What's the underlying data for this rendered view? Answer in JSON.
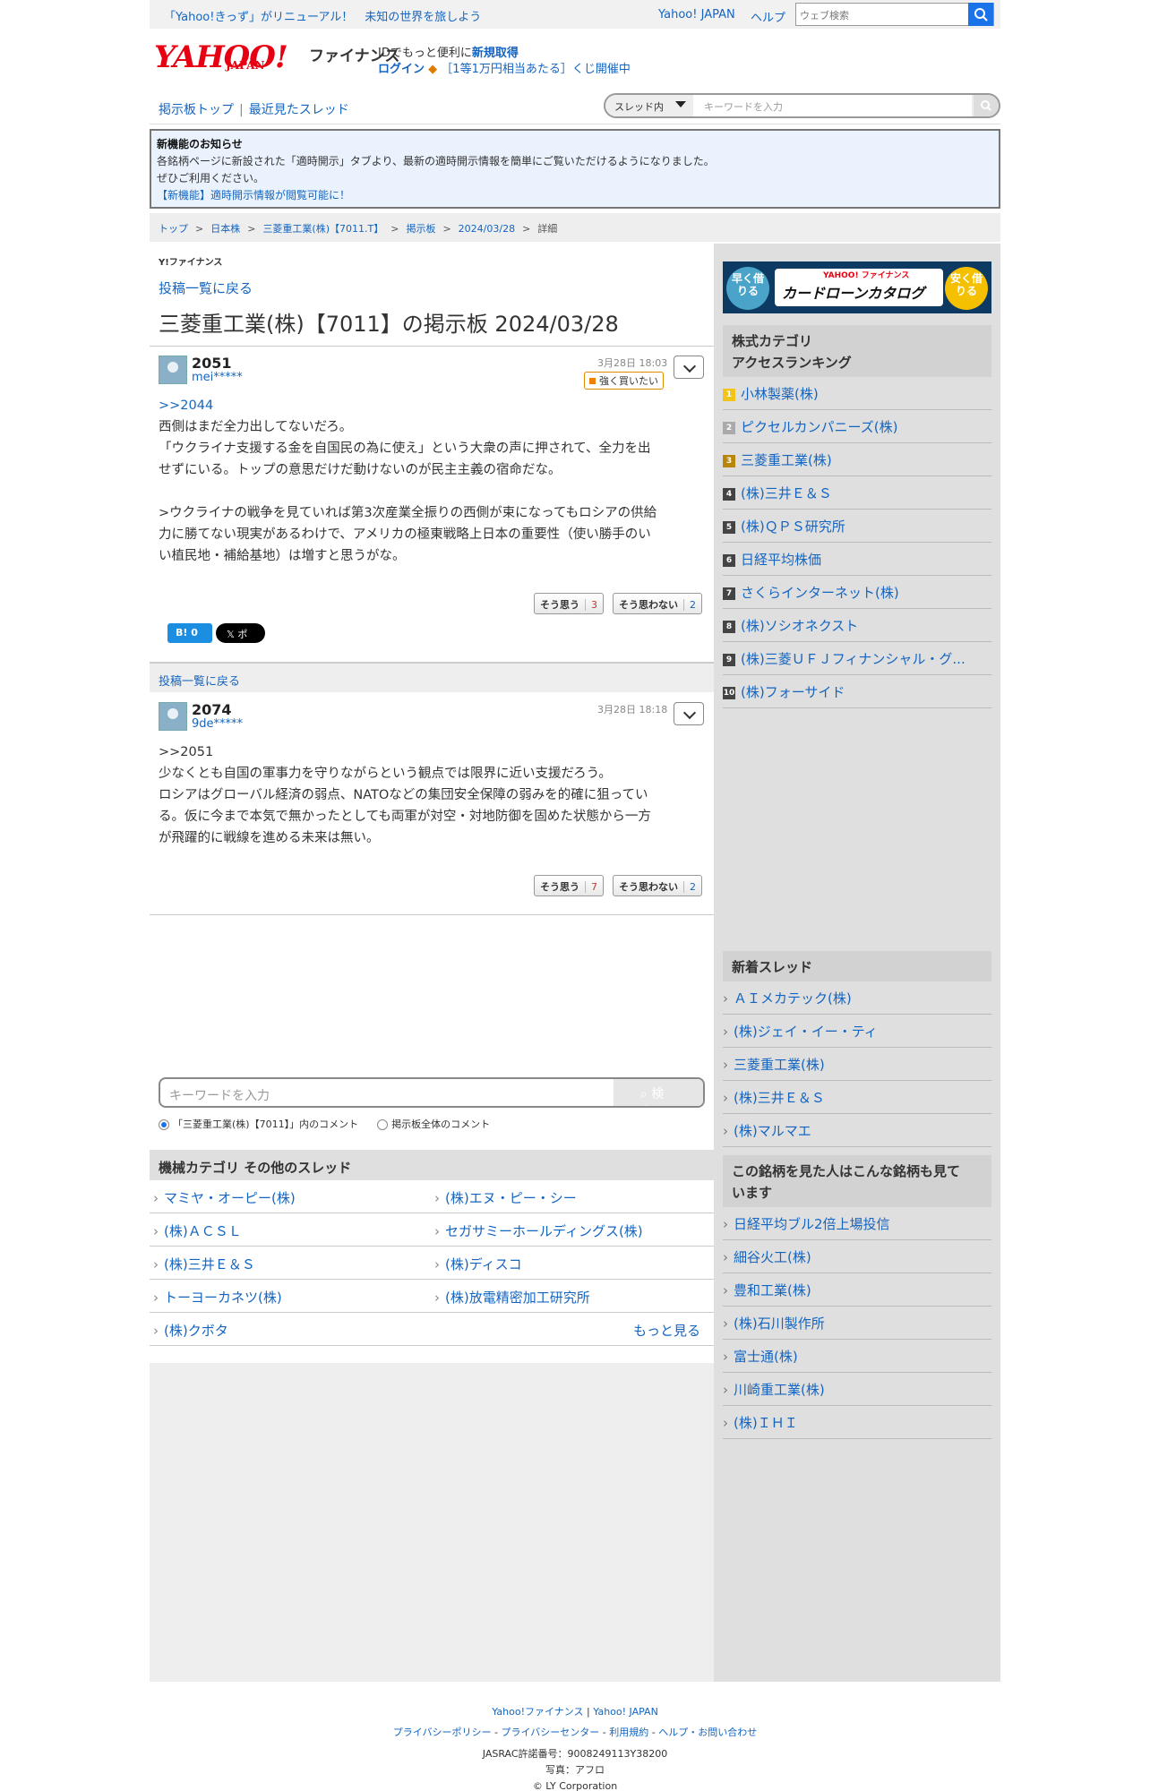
{
  "topbar": {
    "promo": "「Yahoo!きっず」がリニューアル！　未知の世界を旅しよう",
    "yahoo_japan": "Yahoo! JAPAN",
    "help": "ヘルプ",
    "search_placeholder": "ウェブ検索"
  },
  "header": {
    "logo": "YAHOO!",
    "logo_sub": "JAPAN",
    "service": "ファイナンス",
    "id_text": "IDでもっと便利に",
    "signup": "新規取得",
    "login": "ログイン",
    "lottery": "［1等1万円相当あたる］くじ開催中"
  },
  "nav": {
    "board_top": "掲示板トップ",
    "recent": "最近見たスレッド",
    "scope": "スレッド内",
    "placeholder": "キーワードを入力"
  },
  "notice": {
    "title": "新機能のお知らせ",
    "line1": "各銘柄ページに新設された「適時開示」タブより、最新の適時開示情報を簡単にご覧いただけるようになりました。",
    "line2": "ぜひご利用ください。",
    "link": "【新機能】適時開示情報が閲覧可能に！"
  },
  "breadcrumb": [
    "トップ",
    "日本株",
    "三菱重工業(株)【7011.T】",
    "掲示板",
    "2024/03/28",
    "詳細"
  ],
  "page": {
    "yf_small": "Y!ファイナンス",
    "back": "投稿一覧に戻る",
    "title": "三菱重工業(株)【7011】の掲示板 2024/03/28"
  },
  "posts": [
    {
      "num": "2051",
      "user": "mei*****",
      "date": "3月28日 18:03",
      "badge": "強く買いたい",
      "reply": ">>2044",
      "lines": [
        "西側はまだ全力出してないだろ。",
        "「ウクライナ支援する金を自国民の為に使え」という大衆の声に押されて、全力を出",
        "せずにいる。トップの意思だけだ動けないのが民主主義の宿命だな。",
        "",
        "&gt;ウクライナの戦争を見ていれば第3次産業全振りの西側が束になってもロシアの供給",
        "力に勝てない現実があるわけで、アメリカの極東戦略上日本の重要性（使い勝手のい",
        "い植民地・補給基地）は増すと思うがな。"
      ],
      "agree": "そう思う",
      "agree_n": "3",
      "disagree": "そう思わない",
      "disagree_n": "2"
    },
    {
      "num": "2074",
      "user": "9de*****",
      "date": "3月28日 18:18",
      "reply": ">>2051",
      "lines": [
        "少なくとも自国の軍事力を守りながらという観点では限界に近い支援だろう。",
        "ロシアはグローバル経済の弱点、NATOなどの集団安全保障の弱みを的確に狙ってい",
        "る。仮に今まで本気で無かったとしても両軍が対空・対地防御を固めた状態から一方",
        "が飛躍的に戦線を進める未来は無い。"
      ],
      "agree": "そう思う",
      "agree_n": "7",
      "disagree": "そう思わない",
      "disagree_n": "2"
    }
  ],
  "share": {
    "hatena": "B! 0",
    "x": "𝕏 ポスト"
  },
  "back2": "投稿一覧に戻る",
  "bottom_search": {
    "placeholder": "キーワードを入力",
    "button": "検索",
    "radio1": "「三菱重工業(株)【7011】」内のコメント",
    "radio2": "掲示板全体のコメント"
  },
  "category": {
    "title": "機械カテゴリ その他のスレッド",
    "items": [
      "マミヤ・オーピー(株)",
      "(株)エヌ・ピー・シー",
      "(株)ＡＣＳＬ",
      "セガサミーホールディングス(株)",
      "(株)三井Ｅ＆Ｓ",
      "(株)ディスコ",
      "トーヨーカネツ(株)",
      "(株)放電精密加工研究所",
      "(株)クボタ"
    ],
    "more": "もっと見る"
  },
  "ad": {
    "left": "早く借りる",
    "right": "安く借りる",
    "brand": "YAHOO! ファイナンス",
    "text": "カードローンカタログ"
  },
  "ranking": {
    "title1": "株式カテゴリ",
    "title2": "アクセスランキング",
    "items": [
      "小林製薬(株)",
      "ピクセルカンパニーズ(株)",
      "三菱重工業(株)",
      "(株)三井Ｅ＆Ｓ",
      "(株)ＱＰＳ研究所",
      "日経平均株価",
      "さくらインターネット(株)",
      "(株)ソシオネクスト",
      "(株)三菱ＵＦＪフィナンシャル・グ...",
      "(株)フォーサイド"
    ],
    "nums": [
      "1",
      "2",
      "3",
      "4",
      "5",
      "6",
      "7",
      "8",
      "9",
      "10"
    ]
  },
  "new_threads": {
    "title": "新着スレッド",
    "items": [
      "ＡＩメカテック(株)",
      "(株)ジェイ・イー・ティ",
      "三菱重工業(株)",
      "(株)三井Ｅ＆Ｓ",
      "(株)マルマエ"
    ]
  },
  "also": {
    "title1": "この銘柄を見た人はこんな銘柄も見て",
    "title2": "います",
    "items": [
      "日経平均ブル2倍上場投信",
      "細谷火工(株)",
      "豊和工業(株)",
      "(株)石川製作所",
      "富士通(株)",
      "川崎重工業(株)",
      "(株)ＩＨＩ"
    ]
  },
  "footer": {
    "yf": "Yahoo!ファイナンス",
    "yj": "Yahoo! JAPAN",
    "privacy": "プライバシーポリシー",
    "privacy_center": "プライバシーセンター",
    "terms": "利用規約",
    "help": "ヘルプ・お問い合わせ",
    "jasrac": "JASRAC許諾番号：9008249113Y38200",
    "photo": "写真：アフロ",
    "copy": "© LY Corporation"
  },
  "colors": {
    "accent": "#1565c0",
    "brand": "#e60012",
    "notice_bg": "#eaf3fd"
  }
}
